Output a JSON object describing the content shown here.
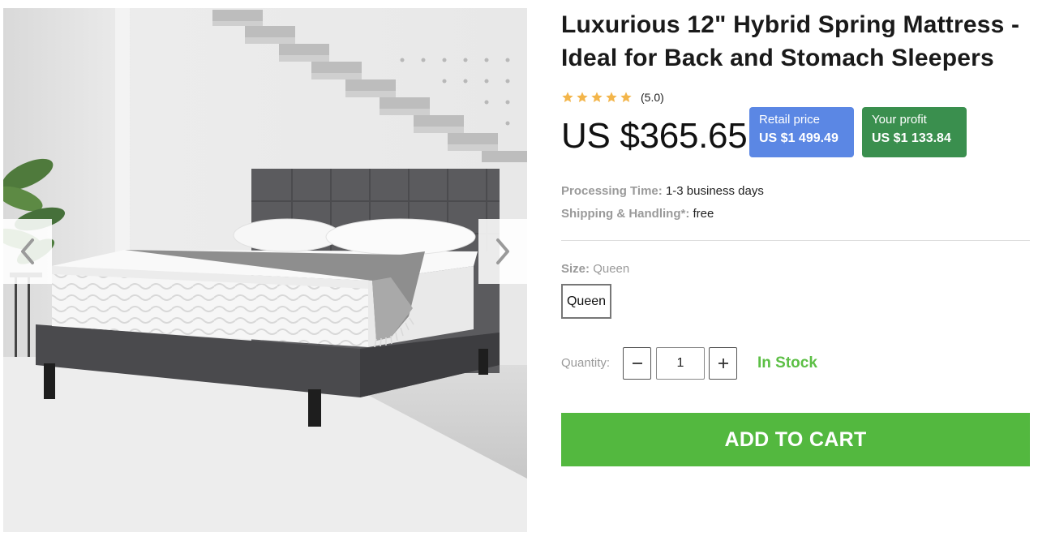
{
  "product": {
    "title": "Luxurious 12\" Hybrid Spring Mattress - Ideal for Back and Stomach Sleepers",
    "rating": {
      "stars": 5,
      "text": "(5.0)"
    },
    "price": "US $365.65",
    "retail": {
      "label": "Retail price",
      "value": "US $1 499.49"
    },
    "profit": {
      "label": "Your profit",
      "value": "US $1 133.84"
    },
    "processing": {
      "label": "Processing Time:",
      "value": "1-3 business days"
    },
    "shipping": {
      "label": "Shipping & Handling*:",
      "value": "free"
    },
    "size": {
      "label": "Size:",
      "selected": "Queen",
      "options": [
        "Queen"
      ]
    },
    "quantity": {
      "label": "Quantity:",
      "value": "1"
    },
    "stock_status": "In Stock",
    "add_to_cart_label": "ADD TO CART"
  },
  "gallery": {
    "prev_icon": "chevron-left-icon",
    "next_icon": "chevron-right-icon"
  },
  "colors": {
    "retail_badge": "#5b87e4",
    "profit_badge": "#3a8f4e",
    "in_stock": "#5cbf45",
    "add_to_cart": "#53b83f",
    "star": "#f3b54a"
  }
}
